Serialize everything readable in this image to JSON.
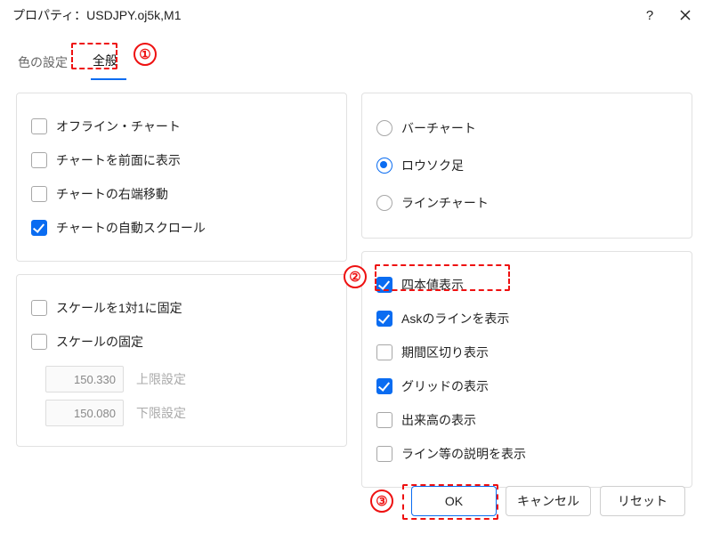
{
  "window": {
    "title": "プロパティ：USDJPY.oj5k,M1"
  },
  "tabs": {
    "color": "色の設定",
    "general": "全般"
  },
  "left": {
    "offline_chart": "オフライン・チャート",
    "chart_front": "チャートを前面に表示",
    "chart_shift": "チャートの右端移動",
    "chart_autoscroll": "チャートの自動スクロール",
    "scale_fix_one": "スケールを1対1に固定",
    "scale_fix": "スケールの固定",
    "upper_value": "150.330",
    "upper_label": "上限設定",
    "lower_value": "150.080",
    "lower_label": "下限設定"
  },
  "right": {
    "bar_chart": "バーチャート",
    "candles": "ロウソク足",
    "line_chart": "ラインチャート",
    "ohlc": "四本値表示",
    "ask_line": "Askのラインを表示",
    "period_sep": "期間区切り表示",
    "grid": "グリッドの表示",
    "volumes": "出来高の表示",
    "descriptions": "ライン等の説明を表示"
  },
  "buttons": {
    "ok": "OK",
    "cancel": "キャンセル",
    "reset": "リセット"
  },
  "callouts": {
    "one": "①",
    "two": "②",
    "three": "③"
  }
}
